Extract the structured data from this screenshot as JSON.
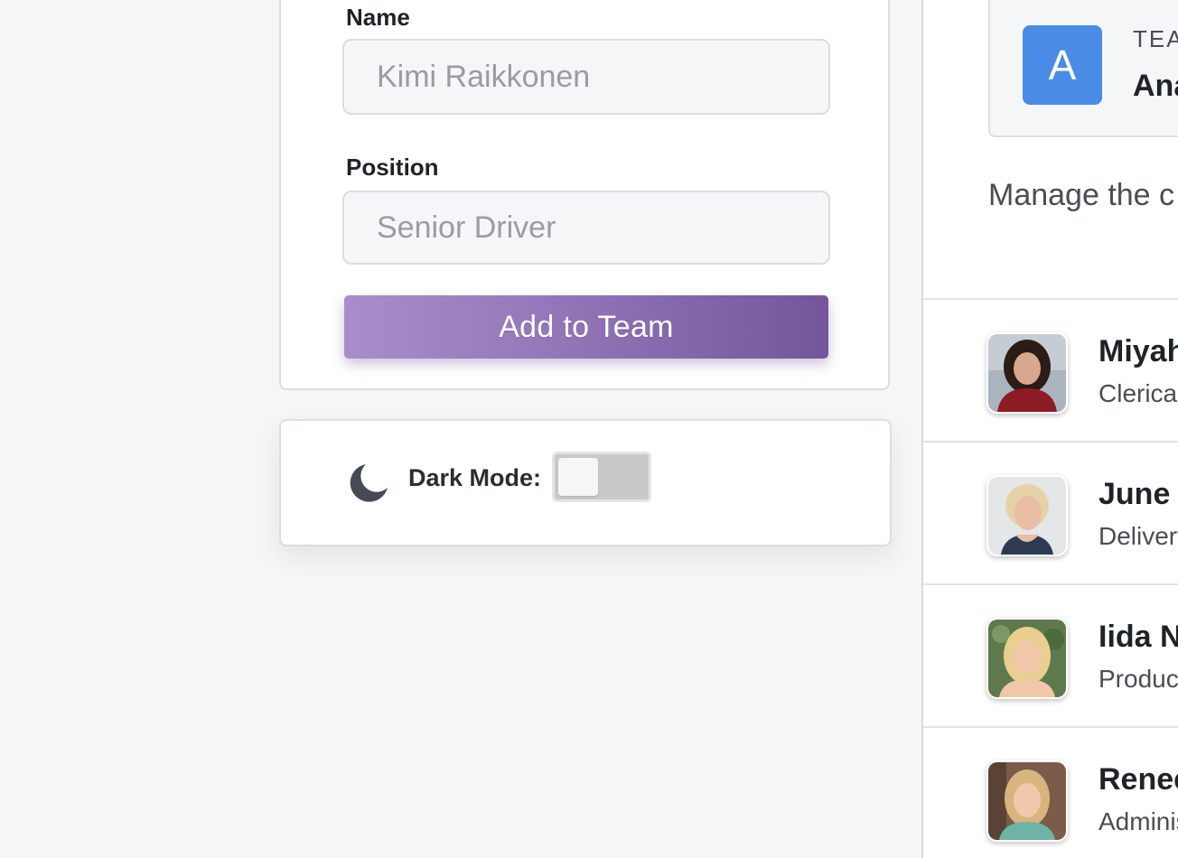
{
  "form": {
    "name_label": "Name",
    "name_value": "Kimi Raikkonen",
    "position_label": "Position",
    "position_value": "Senior Driver",
    "submit_label": "Add to Team"
  },
  "settings": {
    "dark_mode_label": "Dark Mode:",
    "dark_mode_icon": "moon-icon",
    "dark_mode_on": false
  },
  "team": {
    "avatar_letter": "A",
    "kicker": "TEA",
    "name": "Ana",
    "description": "Manage the c customize yo"
  },
  "members": [
    {
      "name": "Miyah",
      "role": "Clerical"
    },
    {
      "name": "June",
      "role": "Delivery"
    },
    {
      "name": "Iida N",
      "role": "Product"
    },
    {
      "name": "Renee",
      "role": "Adminis"
    }
  ],
  "colors": {
    "accent_gradient_start": "#a98dcb",
    "accent_gradient_end": "#74559b",
    "team_avatar": "#4a8be6"
  }
}
